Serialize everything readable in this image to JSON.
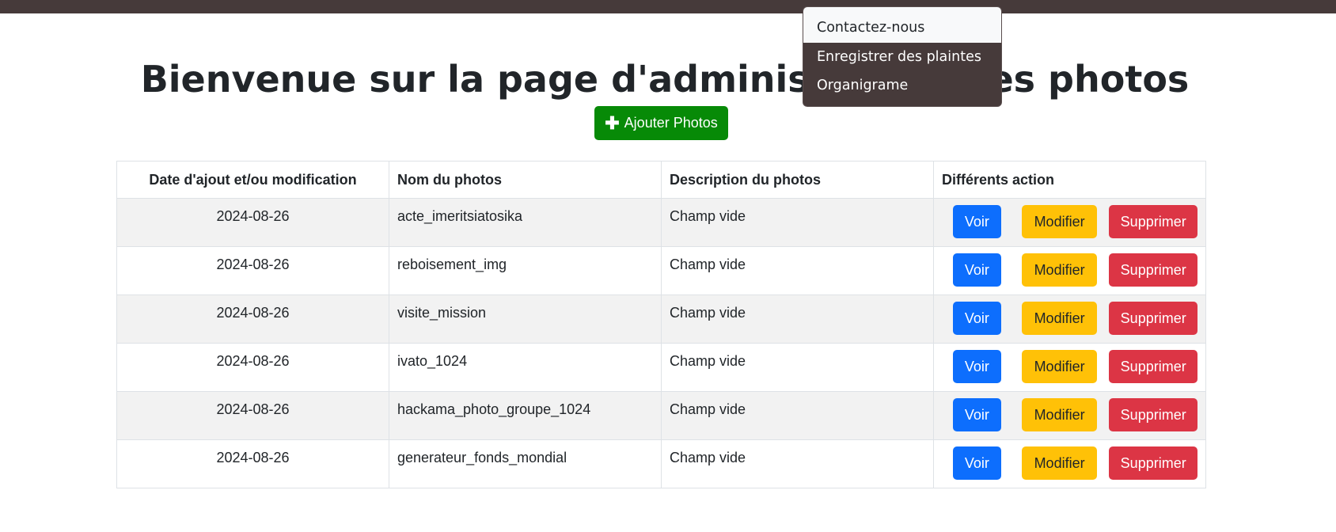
{
  "header": {
    "title": "Bienvenue sur la page d'administration des photos",
    "add_button_label": "Ajouter Photos",
    "add_icon": "plus-icon"
  },
  "dropdown": {
    "items": [
      "Contactez-nous",
      "Enregistrer des plaintes",
      "Organigrame"
    ],
    "active_index": 0
  },
  "table": {
    "headers": [
      "Date d'ajout et/ou modification",
      "Nom du photos",
      "Description du photos",
      "Différents action"
    ],
    "rows": [
      {
        "date": "2024-08-26",
        "name": "acte_imeritsiatosika",
        "description": "Champ vide"
      },
      {
        "date": "2024-08-26",
        "name": "reboisement_img",
        "description": "Champ vide"
      },
      {
        "date": "2024-08-26",
        "name": "visite_mission",
        "description": "Champ vide"
      },
      {
        "date": "2024-08-26",
        "name": "ivato_1024",
        "description": "Champ vide"
      },
      {
        "date": "2024-08-26",
        "name": "hackama_photo_groupe_1024",
        "description": "Champ vide"
      },
      {
        "date": "2024-08-26",
        "name": "generateur_fonds_mondial",
        "description": "Champ vide"
      }
    ],
    "actions": {
      "view": "Voir",
      "edit": "Modifier",
      "delete": "Supprimer"
    }
  },
  "colors": {
    "navbar": "#463a3a",
    "add_button": "#078a07",
    "view_button": "#0d6efd",
    "edit_button": "#ffc107",
    "delete_button": "#dc3545"
  }
}
